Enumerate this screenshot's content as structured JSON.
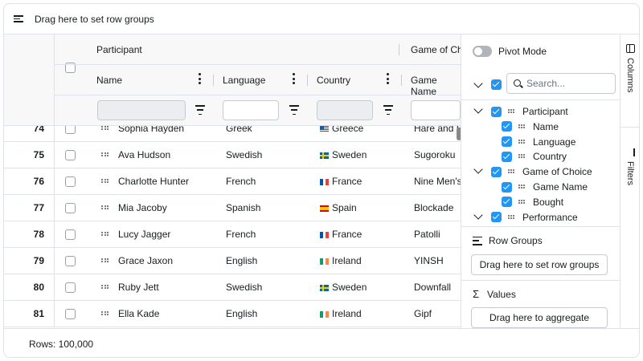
{
  "row_group_panel": {
    "label": "Drag here to set row groups",
    "icon": "row-group-icon"
  },
  "header": {
    "groups": [
      "Participant",
      "Game of Choice"
    ],
    "columns": [
      "Name",
      "Language",
      "Country",
      "Game Name"
    ]
  },
  "rows": [
    {
      "num": "74",
      "name": "Sophia Hayden",
      "language": "Greek",
      "country": "Greece",
      "game": "Hare and Ho"
    },
    {
      "num": "75",
      "name": "Ava Hudson",
      "language": "Swedish",
      "country": "Sweden",
      "game": "Sugoroku"
    },
    {
      "num": "76",
      "name": "Charlotte Hunter",
      "language": "French",
      "country": "France",
      "game": "Nine Men's M"
    },
    {
      "num": "77",
      "name": "Mia Jacoby",
      "language": "Spanish",
      "country": "Spain",
      "game": "Blockade"
    },
    {
      "num": "78",
      "name": "Lucy Jagger",
      "language": "French",
      "country": "France",
      "game": "Patolli"
    },
    {
      "num": "79",
      "name": "Grace Jaxon",
      "language": "English",
      "country": "Ireland",
      "game": "YINSH"
    },
    {
      "num": "80",
      "name": "Ruby Jett",
      "language": "Swedish",
      "country": "Sweden",
      "game": "Downfall"
    },
    {
      "num": "81",
      "name": "Ella Kade",
      "language": "English",
      "country": "Ireland",
      "game": "Gipf"
    }
  ],
  "footer": {
    "rows_label": "Rows: 100,000"
  },
  "tool_panel": {
    "pivot_mode": "Pivot Mode",
    "search_placeholder": "Search...",
    "columns_tree": [
      {
        "label": "Participant",
        "level": 0
      },
      {
        "label": "Name",
        "level": 1
      },
      {
        "label": "Language",
        "level": 1
      },
      {
        "label": "Country",
        "level": 1
      },
      {
        "label": "Game of Choice",
        "level": 0
      },
      {
        "label": "Game Name",
        "level": 1
      },
      {
        "label": "Bought",
        "level": 1
      },
      {
        "label": "Performance",
        "level": 0
      }
    ],
    "row_groups_title": "Row Groups",
    "row_groups_drop": "Drag here to set row groups",
    "values_title": "Values",
    "values_drop": "Drag here to aggregate"
  },
  "side_tabs": {
    "columns": "Columns",
    "filters": "Filters"
  },
  "colors": {
    "accent": "#2196f3",
    "border": "#dde2eb",
    "header_bg": "#f8f8f8"
  }
}
